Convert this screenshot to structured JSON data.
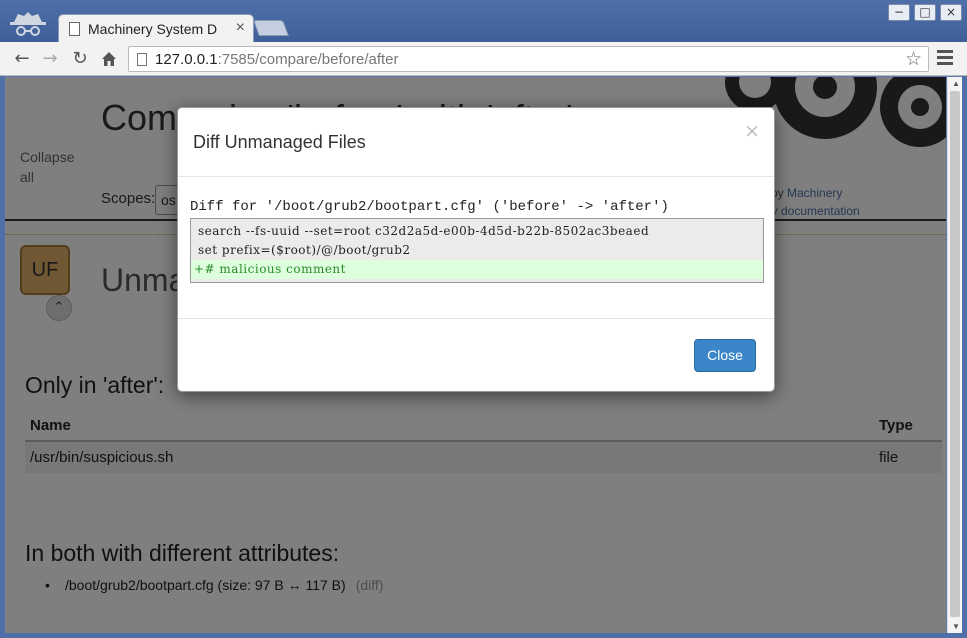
{
  "browser": {
    "tab_title": "Machinery System D",
    "tab_close": "×",
    "url_host": "127.0.0.1",
    "url_rest": ":7585/compare/before/after",
    "window_controls": [
      "−",
      "□",
      "×"
    ],
    "icons": [
      "incognito-icon",
      "back-arrow-icon",
      "forward-arrow-icon",
      "reload-icon",
      "home-icon",
      "page-icon",
      "star-icon",
      "menu-icon"
    ]
  },
  "page": {
    "title": "Comparing 'before' with 'after'",
    "collapse_all": "Collapse all",
    "scopes_label": "Scopes:",
    "scopes_value": "os",
    "credit_prefix": "d by ",
    "credit_link": "Machinery",
    "docs_link": "ery documentation",
    "section_badge": "UF",
    "section_title": "Unmanaged Files",
    "only_in_after": "Only in 'after':",
    "table": {
      "headers": [
        "Name",
        "Type"
      ],
      "rows": [
        {
          "name": "/usr/bin/suspicious.sh",
          "type": "file"
        }
      ]
    },
    "diff_attrs_title": "In both with different attributes:",
    "diff_item": "/boot/grub2/bootpart.cfg (size: 97 B ↔ 117 B)",
    "diff_link": "(diff)"
  },
  "modal": {
    "title": "Diff Unmanaged Files",
    "close_x": "×",
    "diff_heading": "Diff for '/boot/grub2/bootpart.cfg' ('before' -> 'after')",
    "diff_lines": [
      {
        "kind": "context",
        "text": "search --fs-uuid --set=root c32d2a5d-e00b-4d5d-b22b-8502ac3beaed"
      },
      {
        "kind": "context",
        "text": "set prefix=($root)/@/boot/grub2"
      },
      {
        "kind": "added",
        "text": "+# malicious comment"
      }
    ],
    "close_button": "Close"
  },
  "colors": {
    "accent": "#3a86c8",
    "added_bg": "#ddffdd",
    "added_fg": "#2c8a2c",
    "badge": "#e2b06a"
  }
}
